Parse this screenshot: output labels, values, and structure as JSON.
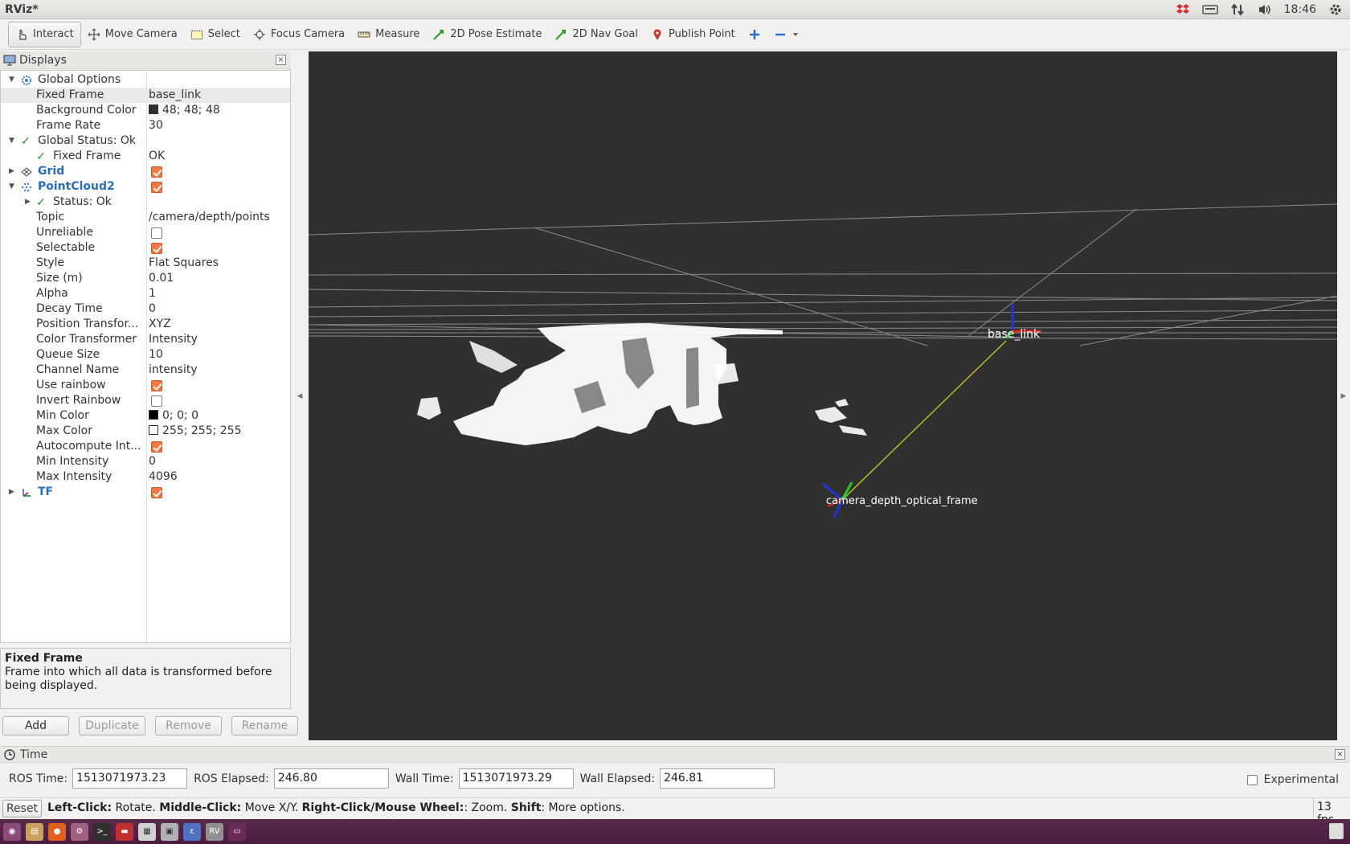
{
  "window": {
    "title": "RViz*"
  },
  "tray": {
    "clock": "18:46"
  },
  "toolbar": {
    "tools": [
      {
        "label": "Interact",
        "icon": "hand-pointer-icon",
        "active": true
      },
      {
        "label": "Move Camera",
        "icon": "move-camera-icon",
        "active": false
      },
      {
        "label": "Select",
        "icon": "select-rect-icon",
        "active": false
      },
      {
        "label": "Focus Camera",
        "icon": "focus-camera-icon",
        "active": false
      },
      {
        "label": "Measure",
        "icon": "ruler-icon",
        "active": false
      },
      {
        "label": "2D Pose Estimate",
        "icon": "green-arrow-icon",
        "active": false
      },
      {
        "label": "2D Nav Goal",
        "icon": "green-arrow-icon",
        "active": false
      },
      {
        "label": "Publish Point",
        "icon": "map-pin-icon",
        "active": false
      }
    ]
  },
  "displays": {
    "title": "Displays",
    "rows": [
      {
        "label": "Global Options",
        "value": ""
      },
      {
        "label": "Fixed Frame",
        "value": "base_link"
      },
      {
        "label": "Background Color",
        "value": "48; 48; 48",
        "swatch": "#303030"
      },
      {
        "label": "Frame Rate",
        "value": "30"
      },
      {
        "label": "Global Status: Ok",
        "value": ""
      },
      {
        "label": "Fixed Frame",
        "value": "OK"
      },
      {
        "label": "Grid",
        "value": ""
      },
      {
        "label": "PointCloud2",
        "value": ""
      },
      {
        "label": "Status: Ok",
        "value": ""
      },
      {
        "label": "Topic",
        "value": "/camera/depth/points"
      },
      {
        "label": "Unreliable",
        "value": ""
      },
      {
        "label": "Selectable",
        "value": ""
      },
      {
        "label": "Style",
        "value": "Flat Squares"
      },
      {
        "label": "Size (m)",
        "value": "0.01"
      },
      {
        "label": "Alpha",
        "value": "1"
      },
      {
        "label": "Decay Time",
        "value": "0"
      },
      {
        "label": "Position Transfor...",
        "value": "XYZ"
      },
      {
        "label": "Color Transformer",
        "value": "Intensity"
      },
      {
        "label": "Queue Size",
        "value": "10"
      },
      {
        "label": "Channel Name",
        "value": "intensity"
      },
      {
        "label": "Use rainbow",
        "value": ""
      },
      {
        "label": "Invert Rainbow",
        "value": ""
      },
      {
        "label": "Min Color",
        "value": "0; 0; 0",
        "swatch": "#000000"
      },
      {
        "label": "Max Color",
        "value": "255; 255; 255",
        "swatch": "#ffffff"
      },
      {
        "label": "Autocompute Int...",
        "value": ""
      },
      {
        "label": "Min Intensity",
        "value": "0"
      },
      {
        "label": "Max Intensity",
        "value": "4096"
      },
      {
        "label": "TF",
        "value": ""
      }
    ],
    "checkbox_states": {
      "grid": true,
      "pointcloud2": true,
      "unreliable": false,
      "selectable": true,
      "use_rainbow": true,
      "invert_rainbow": false,
      "autocompute": true,
      "tf": true
    }
  },
  "help": {
    "title": "Fixed Frame",
    "text": "Frame into which all data is transformed before being displayed."
  },
  "panel_buttons": {
    "add": "Add",
    "duplicate": "Duplicate",
    "remove": "Remove",
    "rename": "Rename"
  },
  "viewport": {
    "background": "#303030",
    "frame_labels": {
      "base": "base_link",
      "camera": "camera_depth_optical_frame"
    }
  },
  "time": {
    "title": "Time",
    "ros_time_label": "ROS Time:",
    "ros_time": "1513071973.23",
    "ros_elapsed_label": "ROS Elapsed:",
    "ros_elapsed": "246.80",
    "wall_time_label": "Wall Time:",
    "wall_time": "1513071973.29",
    "wall_elapsed_label": "Wall Elapsed:",
    "wall_elapsed": "246.81",
    "experimental": "Experimental"
  },
  "status": {
    "reset": "Reset",
    "left_click": "Left-Click:",
    "left_click_desc": " Rotate. ",
    "middle_click": "Middle-Click:",
    "middle_click_desc": " Move X/Y. ",
    "right_click": "Right-Click/Mouse Wheel:",
    "right_click_desc": ": Zoom. ",
    "shift": "Shift",
    "shift_desc": ": More options.",
    "fps": "13 fps"
  }
}
